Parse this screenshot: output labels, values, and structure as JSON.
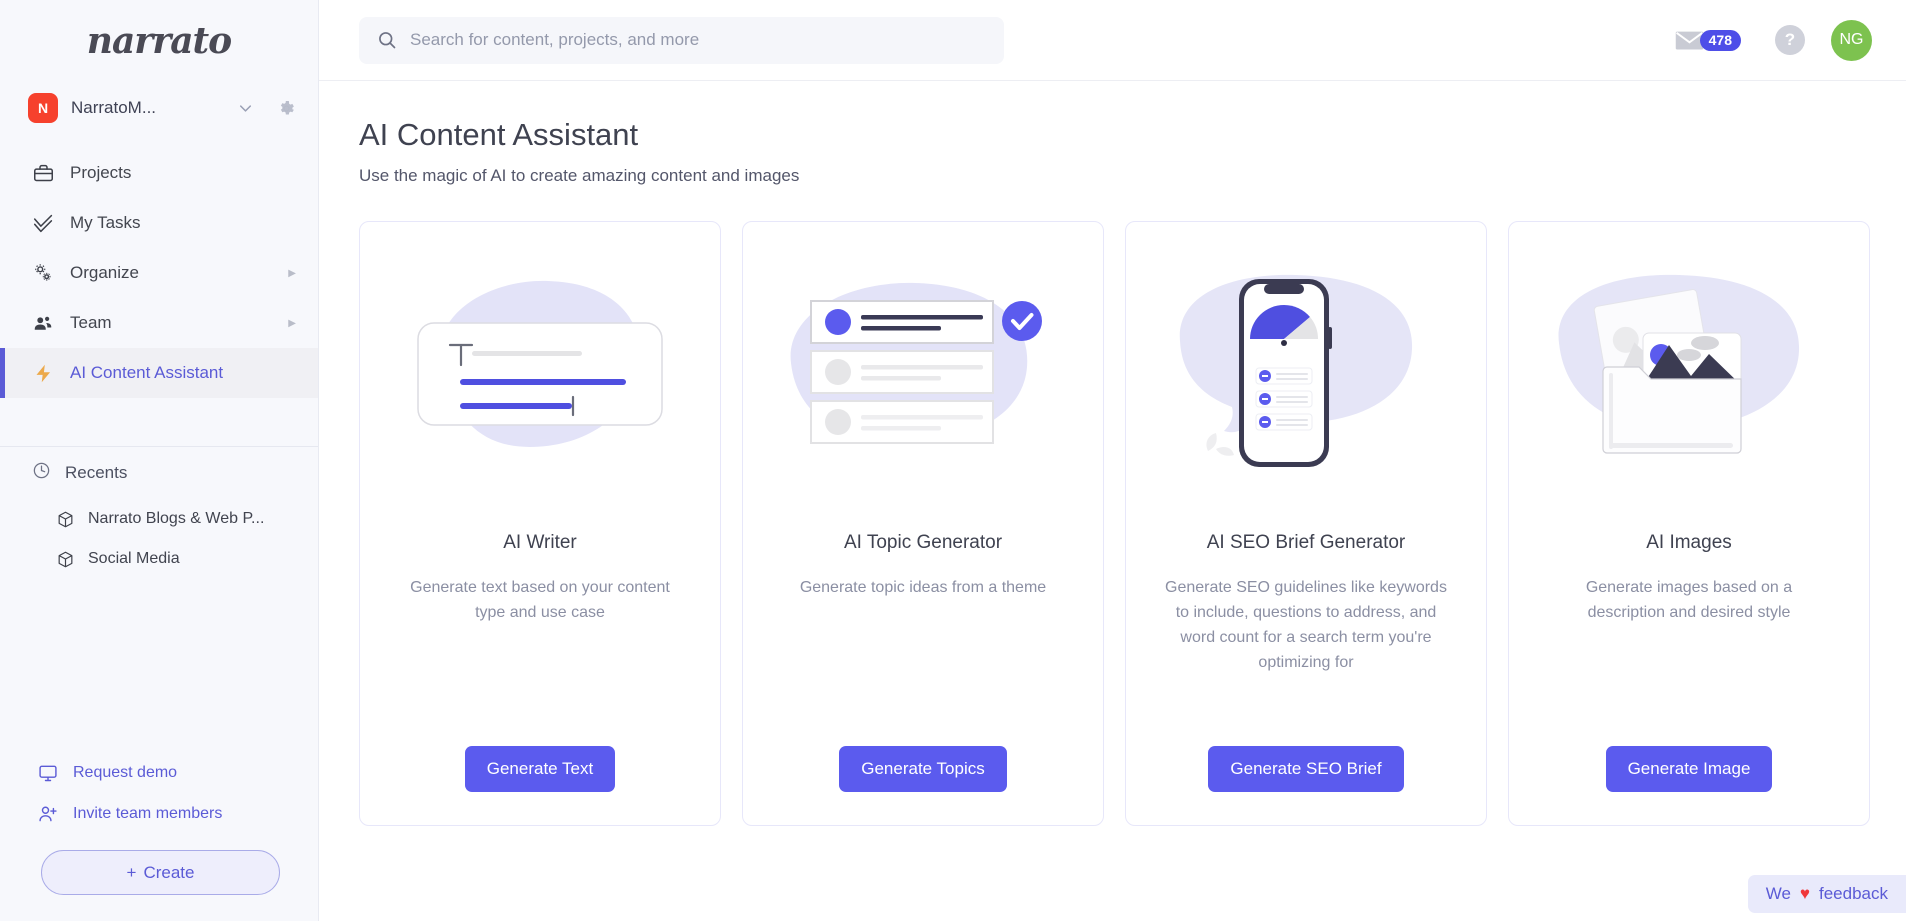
{
  "sidebar": {
    "logo": "narrato",
    "org": {
      "initial": "N",
      "name": "NarratoM...",
      "caret_icon": "chevron-down-icon",
      "gear_icon": "gear-icon"
    },
    "nav": [
      {
        "label": "Projects",
        "icon": "briefcase-icon",
        "arrow": "",
        "active": false
      },
      {
        "label": "My Tasks",
        "icon": "double-check-icon",
        "arrow": "",
        "active": false
      },
      {
        "label": "Organize",
        "icon": "gears-icon",
        "arrow": "▶",
        "active": false
      },
      {
        "label": "Team",
        "icon": "people-icon",
        "arrow": "▶",
        "active": false
      },
      {
        "label": "AI Content Assistant",
        "icon": "lightning-bolt-icon",
        "arrow": "",
        "active": true
      }
    ],
    "recents": {
      "label": "Recents",
      "icon": "clock-icon",
      "items": [
        {
          "label": "Narrato Blogs & Web P...",
          "icon": "cube-icon"
        },
        {
          "label": "Social Media",
          "icon": "cube-icon"
        }
      ]
    },
    "links": [
      {
        "label": "Request demo",
        "icon": "monitor-icon"
      },
      {
        "label": "Invite team members",
        "icon": "user-plus-icon"
      }
    ],
    "create_button": {
      "label": "Create",
      "plus": "+"
    }
  },
  "topbar": {
    "search": {
      "placeholder": "Search for content, projects, and more",
      "value": "",
      "icon": "search-icon"
    },
    "mail": {
      "icon": "envelope-icon",
      "badge": "478"
    },
    "help": {
      "icon": "question-mark-icon",
      "label": "?"
    },
    "avatar": {
      "initials": "NG"
    }
  },
  "page": {
    "title": "AI Content Assistant",
    "subtitle": "Use the magic of AI to create amazing content and images"
  },
  "cards": [
    {
      "title": "AI Writer",
      "description": "Generate text based on your content type and use case",
      "button": "Generate Text",
      "illustration": "text-editor-illustration"
    },
    {
      "title": "AI Topic Generator",
      "description": "Generate topic ideas from a theme",
      "button": "Generate Topics",
      "illustration": "topic-list-illustration"
    },
    {
      "title": "AI SEO Brief Generator",
      "description": "Generate SEO guidelines like keywords to include, questions to address, and word count for a search term you're optimizing for",
      "button": "Generate SEO Brief",
      "illustration": "phone-gauge-illustration"
    },
    {
      "title": "AI Images",
      "description": "Generate images based on a description and desired style",
      "button": "Generate Image",
      "illustration": "image-folder-illustration"
    }
  ],
  "feedback": {
    "prefix": "We",
    "heart": "♥",
    "suffix": "feedback"
  },
  "colors": {
    "accent": "#5b5bee",
    "sidebar_bg": "#f7f8fc",
    "badge": "#4e4ee8",
    "avatar": "#7dc24f",
    "org_badge": "#f6412d",
    "bolt": "#eca94b",
    "heart": "#f0373a"
  }
}
